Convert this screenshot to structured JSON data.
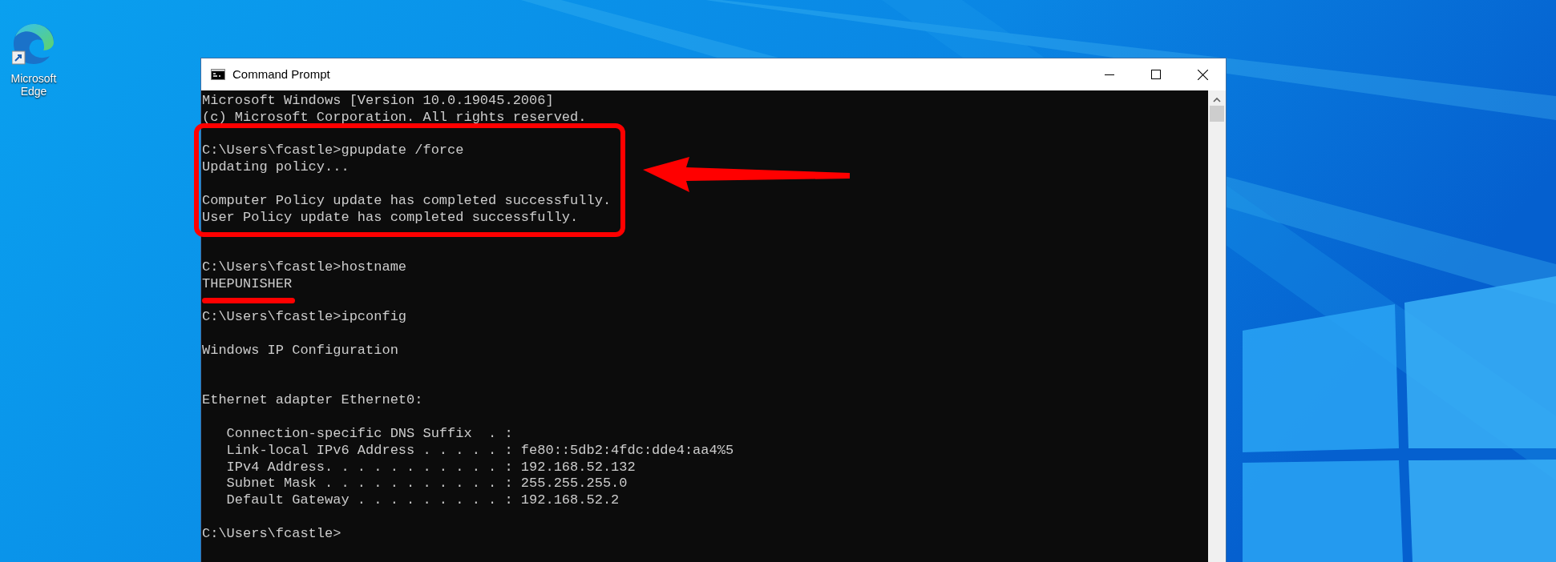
{
  "desktop_icons": [
    {
      "label": "Microsoft Edge"
    }
  ],
  "window": {
    "title": "Command Prompt"
  },
  "console": {
    "lines": [
      {
        "kind": "text",
        "text": "Microsoft Windows [Version 10.0.19045.2006]"
      },
      {
        "kind": "text",
        "text": "(c) Microsoft Corporation. All rights reserved."
      },
      {
        "kind": "blank"
      },
      {
        "kind": "text",
        "text": "C:\\Users\\fcastle>gpupdate /force",
        "boxed": true
      },
      {
        "kind": "text",
        "text": "Updating policy...",
        "boxed": true
      },
      {
        "kind": "blank"
      },
      {
        "kind": "text",
        "text": "Computer Policy update has completed successfully.",
        "boxed": true
      },
      {
        "kind": "text",
        "text": "User Policy update has completed successfully.",
        "boxed": true
      },
      {
        "kind": "blank"
      },
      {
        "kind": "blank"
      },
      {
        "kind": "text",
        "text": "C:\\Users\\fcastle>hostname"
      },
      {
        "kind": "text",
        "text": "THEPUNISHER",
        "underlined": true
      },
      {
        "kind": "blank"
      },
      {
        "kind": "text",
        "text": "C:\\Users\\fcastle>ipconfig"
      },
      {
        "kind": "blank"
      },
      {
        "kind": "text",
        "text": "Windows IP Configuration"
      },
      {
        "kind": "blank"
      },
      {
        "kind": "blank"
      },
      {
        "kind": "text",
        "text": "Ethernet adapter Ethernet0:"
      },
      {
        "kind": "blank"
      },
      {
        "kind": "text",
        "text": "   Connection-specific DNS Suffix  . :"
      },
      {
        "kind": "text",
        "text": "   Link-local IPv6 Address . . . . . : fe80::5db2:4fdc:dde4:aa4%5"
      },
      {
        "kind": "text",
        "text": "   IPv4 Address. . . . . . . . . . . : 192.168.52.132"
      },
      {
        "kind": "text",
        "text": "   Subnet Mask . . . . . . . . . . . : 255.255.255.0"
      },
      {
        "kind": "text",
        "text": "   Default Gateway . . . . . . . . . : 192.168.52.2"
      },
      {
        "kind": "blank"
      },
      {
        "kind": "text",
        "text": "C:\\Users\\fcastle>"
      }
    ]
  }
}
